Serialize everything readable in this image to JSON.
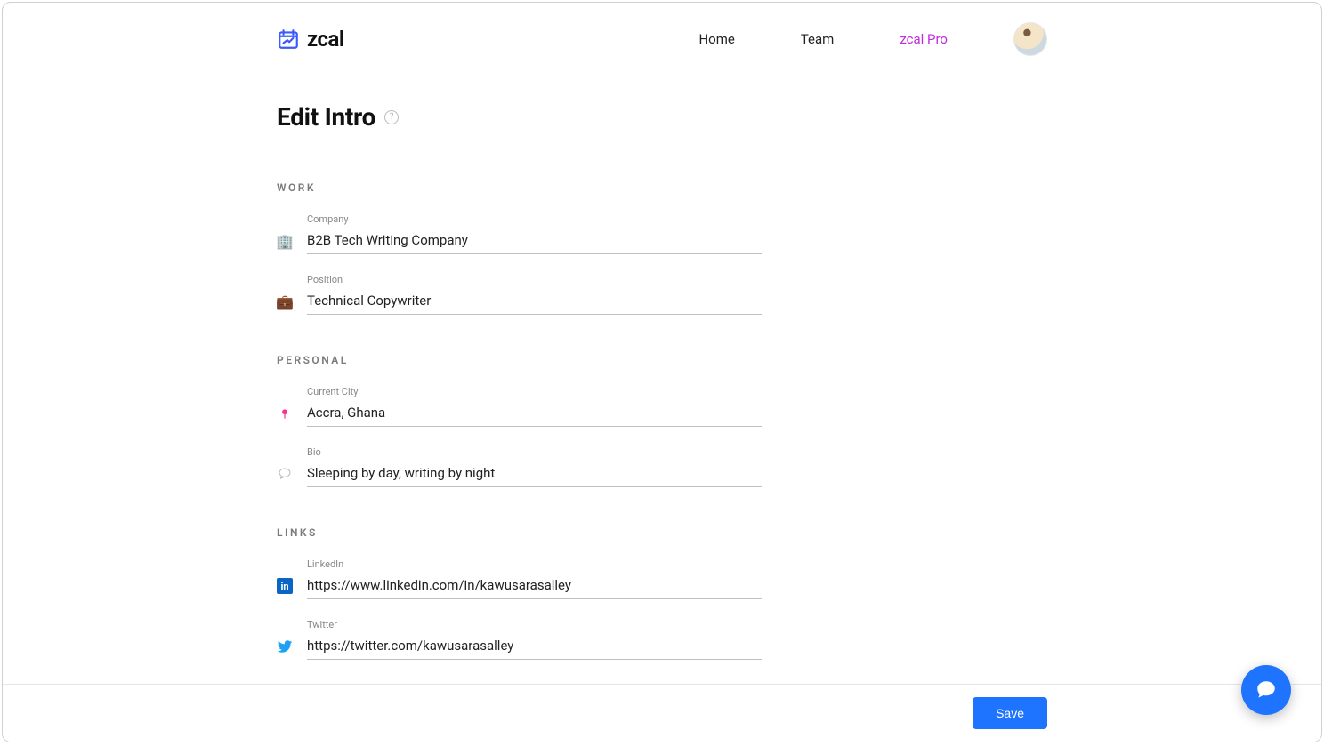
{
  "brand": {
    "name": "zcal"
  },
  "nav": {
    "home": "Home",
    "team": "Team",
    "pro": "zcal Pro"
  },
  "page": {
    "title": "Edit Intro"
  },
  "sections": {
    "work": {
      "heading": "WORK",
      "company": {
        "label": "Company",
        "value": "B2B Tech Writing Company"
      },
      "position": {
        "label": "Position",
        "value": "Technical Copywriter"
      }
    },
    "personal": {
      "heading": "PERSONAL",
      "city": {
        "label": "Current City",
        "value": "Accra, Ghana"
      },
      "bio": {
        "label": "Bio",
        "value": "Sleeping by day, writing by night"
      }
    },
    "links": {
      "heading": "LINKS",
      "linkedin": {
        "label": "LinkedIn",
        "value": "https://www.linkedin.com/in/kawusarasalley"
      },
      "twitter": {
        "label": "Twitter",
        "value": "https://twitter.com/kawusarasalley"
      }
    }
  },
  "actions": {
    "save": "Save"
  }
}
